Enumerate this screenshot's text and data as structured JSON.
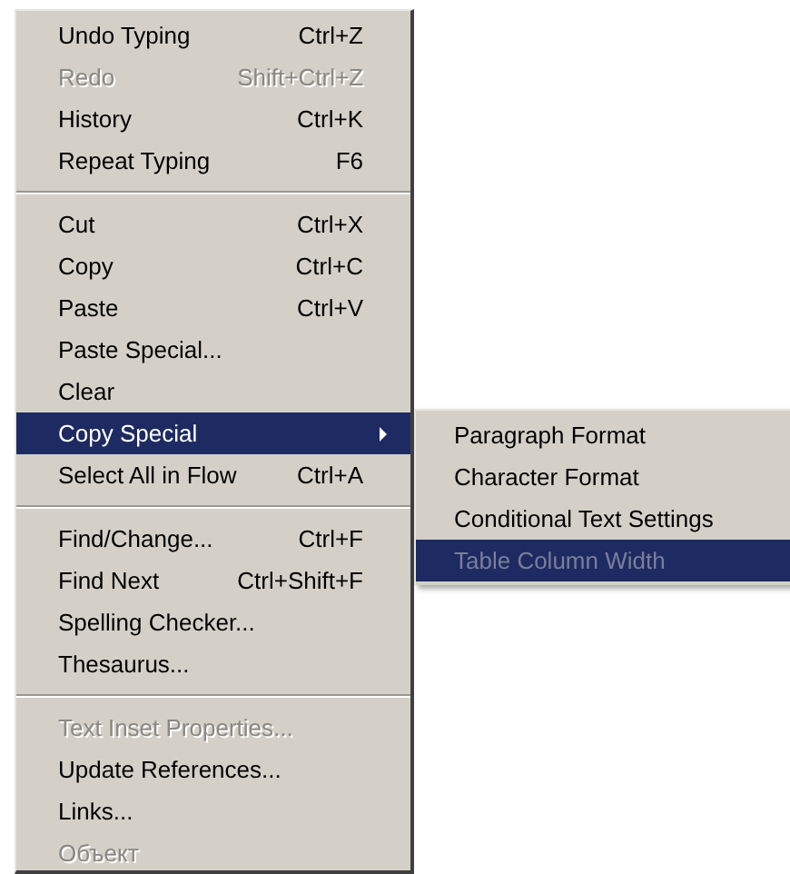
{
  "menu": {
    "sections": [
      {
        "items": [
          {
            "label": "Undo Typing",
            "shortcut": "Ctrl+Z",
            "disabled": false,
            "selected": false
          },
          {
            "label": "Redo",
            "shortcut": "Shift+Ctrl+Z",
            "disabled": true,
            "selected": false
          },
          {
            "label": "History",
            "shortcut": "Ctrl+K",
            "disabled": false,
            "selected": false
          },
          {
            "label": "Repeat Typing",
            "shortcut": "F6",
            "disabled": false,
            "selected": false
          }
        ]
      },
      {
        "items": [
          {
            "label": "Cut",
            "shortcut": "Ctrl+X",
            "disabled": false,
            "selected": false
          },
          {
            "label": "Copy",
            "shortcut": "Ctrl+C",
            "disabled": false,
            "selected": false
          },
          {
            "label": "Paste",
            "shortcut": "Ctrl+V",
            "disabled": false,
            "selected": false
          },
          {
            "label": "Paste Special...",
            "disabled": false,
            "selected": false
          },
          {
            "label": "Clear",
            "disabled": false,
            "selected": false
          },
          {
            "label": "Copy Special",
            "disabled": false,
            "selected": true,
            "submenu": [
              {
                "label": "Paragraph Format",
                "disabled": false,
                "selected": false
              },
              {
                "label": "Character Format",
                "disabled": false,
                "selected": false
              },
              {
                "label": "Conditional Text Settings",
                "disabled": false,
                "selected": false
              },
              {
                "label": "Table Column Width",
                "disabled": true,
                "selected": true
              }
            ]
          },
          {
            "label": "Select All in Flow",
            "shortcut": "Ctrl+A",
            "disabled": false,
            "selected": false
          }
        ]
      },
      {
        "items": [
          {
            "label": "Find/Change...",
            "shortcut": "Ctrl+F",
            "disabled": false,
            "selected": false
          },
          {
            "label": "Find Next",
            "shortcut": "Ctrl+Shift+F",
            "disabled": false,
            "selected": false
          },
          {
            "label": "Spelling Checker...",
            "disabled": false,
            "selected": false
          },
          {
            "label": "Thesaurus...",
            "disabled": false,
            "selected": false
          }
        ]
      },
      {
        "items": [
          {
            "label": "Text Inset Properties...",
            "disabled": true,
            "selected": false
          },
          {
            "label": "Update References...",
            "disabled": false,
            "selected": false
          },
          {
            "label": "Links...",
            "disabled": false,
            "selected": false
          },
          {
            "label": "Объект",
            "disabled": true,
            "selected": false
          }
        ]
      }
    ]
  }
}
